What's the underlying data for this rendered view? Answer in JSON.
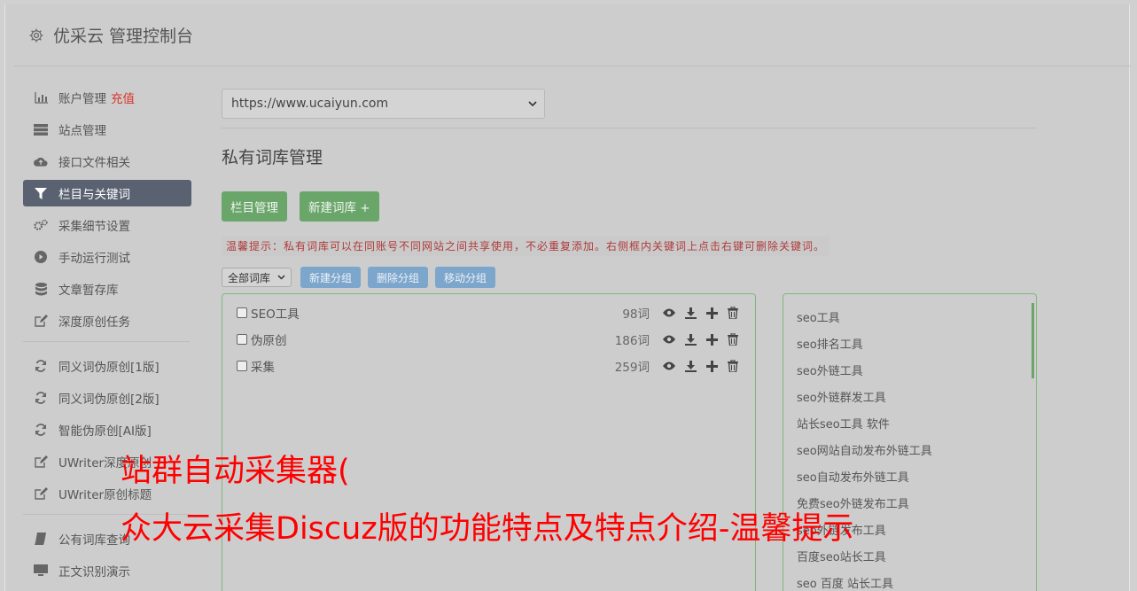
{
  "header": {
    "title": "优采云 管理控制台",
    "icon": "gear-icon"
  },
  "sidebar": {
    "recharge": "充值",
    "items": [
      {
        "label": "账户管理",
        "icon": "bar-chart-icon"
      },
      {
        "label": "站点管理",
        "icon": "server-icon"
      },
      {
        "label": "接口文件相关",
        "icon": "cloud-upload-icon"
      },
      {
        "label": "栏目与关键词",
        "icon": "filter-icon"
      },
      {
        "label": "采集细节设置",
        "icon": "gears-icon"
      },
      {
        "label": "手动运行测试",
        "icon": "play-icon"
      },
      {
        "label": "文章暂存库",
        "icon": "database-icon"
      },
      {
        "label": "深度原创任务",
        "icon": "edit-icon"
      },
      {
        "label": "同义词伪原创[1版]",
        "icon": "refresh-icon"
      },
      {
        "label": "同义词伪原创[2版]",
        "icon": "refresh-icon"
      },
      {
        "label": "智能伪原创[AI版]",
        "icon": "refresh-icon"
      },
      {
        "label": "UWriter深度原创",
        "icon": "edit-icon"
      },
      {
        "label": "UWriter原创标题",
        "icon": "edit-icon"
      },
      {
        "label": "公有词库查询",
        "icon": "book-icon"
      },
      {
        "label": "正文识别演示",
        "icon": "monitor-icon"
      }
    ]
  },
  "main": {
    "site_select": "https://www.ucaiyun.com",
    "page_title": "私有词库管理",
    "btn_columns": "栏目管理",
    "btn_new_lib": "新建词库 +",
    "tip": "温馨提示：私有词库可以在同账号不同网站之间共享使用，不必重复添加。右侧框内关键词上点击右键可删除关键词。",
    "group_select": "全部词库",
    "btn_new_group": "新建分组",
    "btn_delete_group": "删除分组",
    "btn_move_group": "移动分组",
    "libraries": [
      {
        "name": "SEO工具",
        "count": "98词"
      },
      {
        "name": "伪原创",
        "count": "186词"
      },
      {
        "name": "采集",
        "count": "259词"
      }
    ],
    "keywords": [
      "seo工具",
      "seo排名工具",
      "seo外链工具",
      "seo外链群发工具",
      "站长seo工具 软件",
      "seo网站自动发布外链工具",
      "seo自动发布外链工具",
      "免费seo外链发布工具",
      "seo外链发布工具",
      "百度seo站长工具",
      "seo 百度 站长工具"
    ]
  },
  "overlay": {
    "line1": "站群自动采集器(",
    "line2": "众大云采集Discuz版的功能特点及特点介绍-温馨提示"
  },
  "colors": {
    "active_nav": "#5a6170",
    "green": "#6aa56a",
    "blue": "#7ca6cc",
    "red": "#ff0000"
  }
}
